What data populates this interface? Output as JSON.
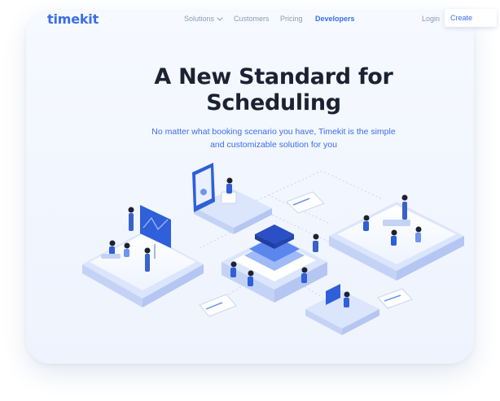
{
  "brand": {
    "logo_text": "timekit"
  },
  "nav": {
    "items": [
      {
        "label": "Solutions",
        "has_dropdown": true
      },
      {
        "label": "Customers"
      },
      {
        "label": "Pricing"
      },
      {
        "label": "Developers",
        "active": true
      }
    ],
    "login_label": "Login",
    "create_label": "Create"
  },
  "hero": {
    "title_line1": "A New Standard for",
    "title_line2": "Scheduling",
    "subtitle_line1": "No matter what booking scenario you have, Timekit is the simple",
    "subtitle_line2": "and customizable solution for you"
  },
  "colors": {
    "brand": "#3a6ee8",
    "heading": "#1c2233",
    "nav_text": "#8e9bb3",
    "platform": "#ffffff",
    "accent_dark": "#2b4fc4"
  }
}
